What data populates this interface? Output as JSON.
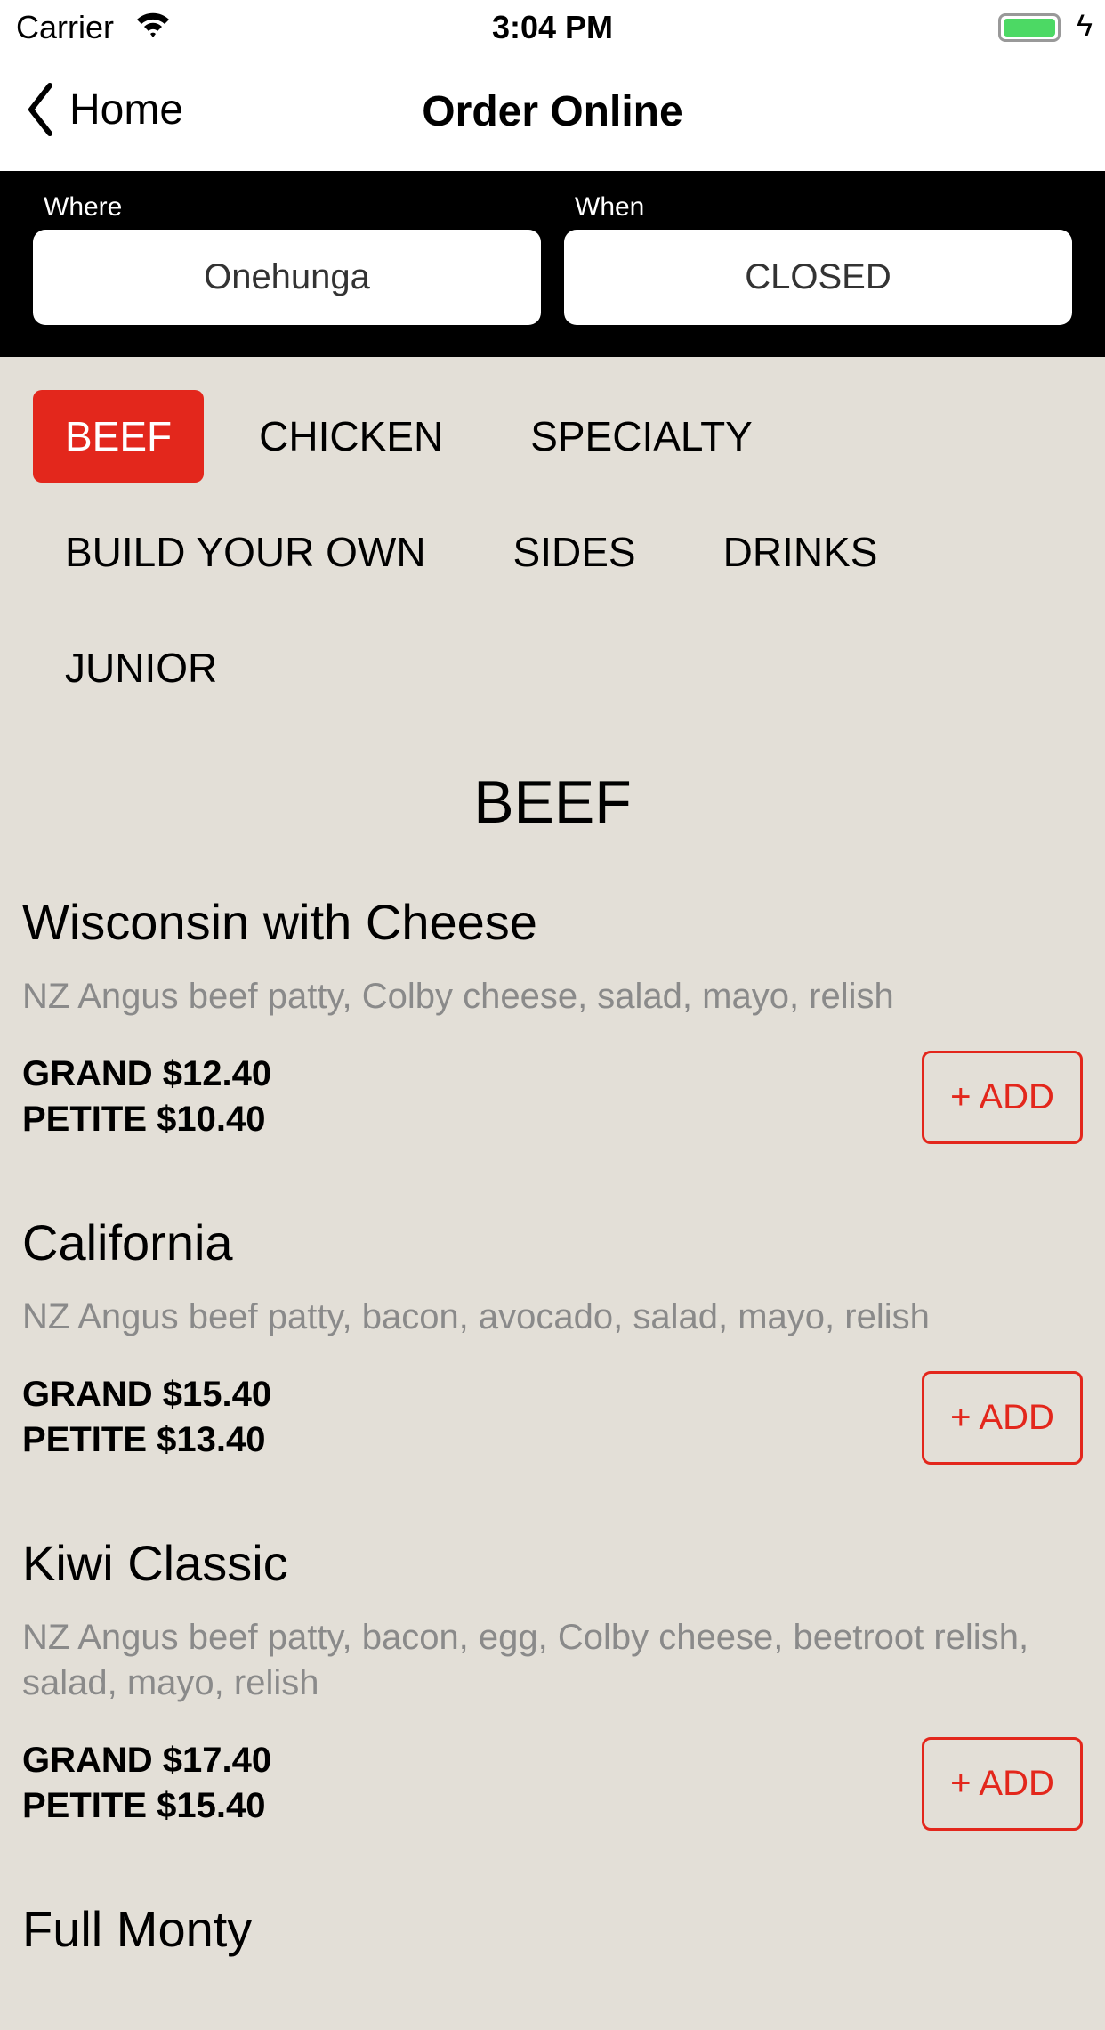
{
  "status_bar": {
    "carrier": "Carrier",
    "time": "3:04 PM",
    "battery_color": "#4cd964"
  },
  "nav": {
    "back_label": "Home",
    "title": "Order Online"
  },
  "selector": {
    "where_label": "Where",
    "where_value": "Onehunga",
    "when_label": "When",
    "when_value": "CLOSED"
  },
  "tabs": [
    {
      "label": "BEEF",
      "active": true
    },
    {
      "label": "CHICKEN"
    },
    {
      "label": "SPECIALTY"
    },
    {
      "label": "BUILD YOUR OWN"
    },
    {
      "label": "SIDES"
    },
    {
      "label": "DRINKS"
    },
    {
      "label": "JUNIOR"
    }
  ],
  "section_title": "BEEF",
  "colors": {
    "accent": "#e3271c",
    "background": "#e3dfd7"
  },
  "items": [
    {
      "name": "Wisconsin with Cheese",
      "description": "NZ Angus beef patty, Colby cheese, salad, mayo, relish",
      "grand": "GRAND $12.40",
      "petite": "PETITE $10.40",
      "add": "+ ADD"
    },
    {
      "name": "California",
      "description": "NZ Angus beef patty, bacon, avocado, salad, mayo, relish",
      "grand": "GRAND $15.40",
      "petite": "PETITE $13.40",
      "add": "+ ADD"
    },
    {
      "name": "Kiwi Classic",
      "description": "NZ Angus beef patty, bacon, egg, Colby cheese, beetroot relish, salad, mayo, relish",
      "grand": "GRAND $17.40",
      "petite": "PETITE $15.40",
      "add": "+ ADD"
    },
    {
      "name": "Full Monty"
    }
  ]
}
